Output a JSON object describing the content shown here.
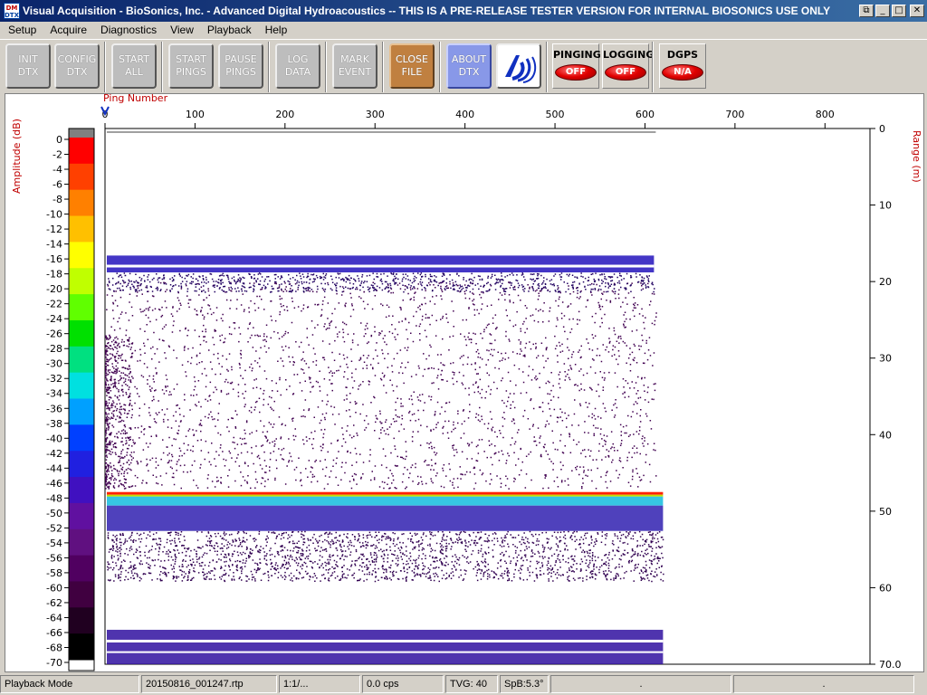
{
  "window": {
    "title": "Visual Acquisition  -  BioSonics, Inc.  -  Advanced Digital Hydroacoustics  -- THIS IS A PRE-RELEASE TESTER VERSION FOR INTERNAL BIOSONICS USE ONLY",
    "icon_text_top": "DM",
    "icon_text_bottom": "DTX"
  },
  "menu": {
    "items": [
      {
        "label": "Setup"
      },
      {
        "label": "Acquire"
      },
      {
        "label": "Diagnostics"
      },
      {
        "label": "View"
      },
      {
        "label": "Playback"
      },
      {
        "label": "Help"
      }
    ]
  },
  "toolbar": {
    "init_l1": "INIT",
    "init_l2": "DTX",
    "config_l1": "CONFIG",
    "config_l2": "DTX",
    "startall_l1": "START",
    "startall_l2": "ALL",
    "startpings_l1": "START",
    "startpings_l2": "PINGS",
    "pausepings_l1": "PAUSE",
    "pausepings_l2": "PINGS",
    "logdata_l1": "LOG",
    "logdata_l2": "DATA",
    "mark_l1": "MARK",
    "mark_l2": "EVENT",
    "closefile_l1": "CLOSE",
    "closefile_l2": "FILE",
    "about_l1": "ABOUT",
    "about_l2": "DTX",
    "pinging_label": "PINGING",
    "pinging_state": "OFF",
    "logging_label": "LOGGING",
    "logging_state": "OFF",
    "dgps_label": "DGPS",
    "dgps_state": "N/A"
  },
  "echogram": {
    "ping_axis_label": "Ping Number",
    "ping_ticks": [
      "0",
      "100",
      "200",
      "300",
      "400",
      "500",
      "600",
      "700",
      "800"
    ],
    "ping_max": 850,
    "range_axis_label": "Range (m)",
    "range_ticks": [
      "0",
      "10",
      "20",
      "30",
      "40",
      "50",
      "60",
      "70.0"
    ],
    "range_max": 70,
    "amplitude_label": "Amplitude (dB)",
    "amplitude_ticks": [
      "0",
      "-2",
      "-4",
      "-6",
      "-8",
      "-10",
      "-12",
      "-14",
      "-16",
      "-18",
      "-20",
      "-22",
      "-24",
      "-26",
      "-28",
      "-30",
      "-32",
      "-34",
      "-36",
      "-38",
      "-40",
      "-42",
      "-44",
      "-46",
      "-48",
      "-50",
      "-52",
      "-54",
      "-56",
      "-58",
      "-60",
      "-62",
      "-64",
      "-66",
      "-68",
      "-70"
    ],
    "pings_recorded": 612,
    "bottom_range_m": 47.5,
    "colors": {
      "bottom": "#ff2000",
      "scatter": "#400050",
      "band": "#3020c0"
    }
  },
  "status": {
    "mode": "Playback Mode",
    "file": "20150816_001247.rtp",
    "ratio": "1:1/...",
    "cps": "0.0 cps",
    "tvg": "TVG: 40",
    "spb": "SpB:5.3°",
    "cell7": ".",
    "cell8": "."
  }
}
